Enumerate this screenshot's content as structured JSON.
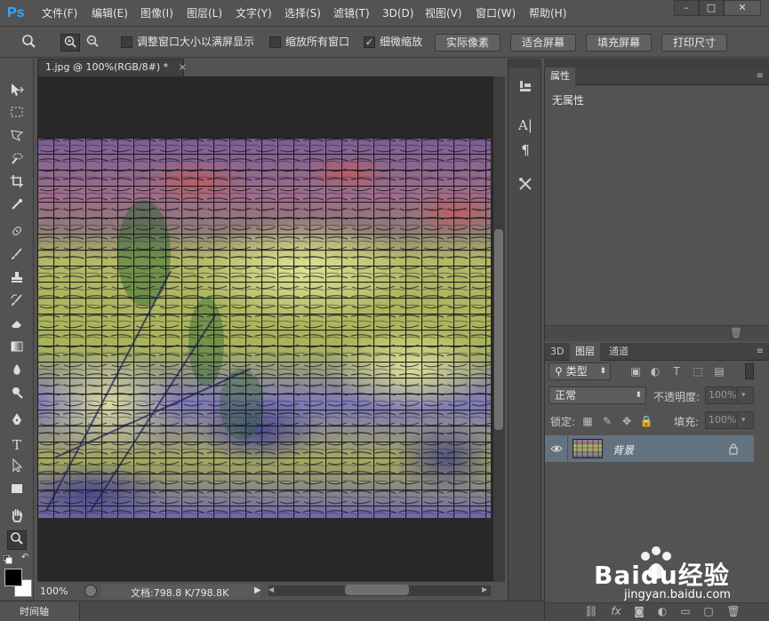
{
  "app": {
    "logo": "Ps"
  },
  "menu": [
    "文件(F)",
    "编辑(E)",
    "图像(I)",
    "图层(L)",
    "文字(Y)",
    "选择(S)",
    "滤镜(T)",
    "3D(D)",
    "视图(V)",
    "窗口(W)",
    "帮助(H)"
  ],
  "window_controls": [
    "–",
    "□",
    "✕"
  ],
  "options": {
    "resize_windows": {
      "label": "调整窗口大小以满屏显示",
      "checked": false
    },
    "zoom_all_windows": {
      "label": "缩放所有窗口",
      "checked": false
    },
    "scrubby_zoom": {
      "label": "细微缩放",
      "checked": true
    },
    "buttons": [
      "实际像素",
      "适合屏幕",
      "填充屏幕",
      "打印尺寸"
    ]
  },
  "document": {
    "tab_title": "1.jpg @ 100%(RGB/8#) *",
    "zoom": "100%",
    "doc_info": "文档:798.8 K/798.8K"
  },
  "timeline": {
    "label": "时间轴"
  },
  "properties": {
    "tab": "属性",
    "content": "无属性"
  },
  "layers_panel": {
    "tabs": [
      "3D",
      "图层",
      "通道"
    ],
    "filter_kind": "类型",
    "blend_mode": "正常",
    "opacity_label": "不透明度:",
    "opacity_value": "100%",
    "lock_label": "锁定:",
    "fill_label": "填充:",
    "fill_value": "100%",
    "layers": [
      {
        "name": "背景",
        "visible": true,
        "locked": true
      }
    ]
  },
  "watermark": {
    "brand": "Baidu经验",
    "url": "jingyan.baidu.com"
  }
}
